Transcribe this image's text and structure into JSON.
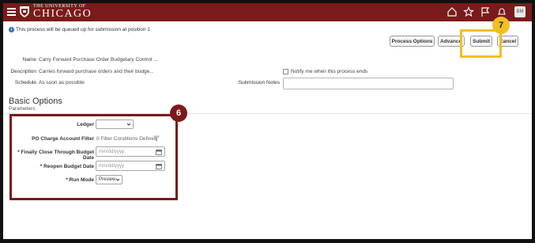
{
  "header": {
    "logo_line1": "THE UNIVERSITY OF",
    "logo_line2": "CHICAGO",
    "avatar_initials": "BM",
    "icons": [
      "home-icon",
      "star-icon",
      "flag-icon",
      "bell-icon"
    ]
  },
  "info_message": "This process will be queued up for submission at position 1",
  "buttons": {
    "process_options": "Process Options",
    "advanced": "Advance",
    "submit": "Submit",
    "cancel": "Cancel"
  },
  "callouts": {
    "step7": "7",
    "step6": "6"
  },
  "form": {
    "name_label": "Name",
    "name_value": "Carry Forward Purchase Order Budgetary Control ...",
    "description_label": "Description",
    "description_value": "Carries forward purchase orders and their budge...",
    "schedule_label": "Schedule",
    "schedule_value": "As soon as possible",
    "notify_label": "Notify me when this process ends",
    "submission_notes_label": "Submission Notes",
    "submission_notes_value": ""
  },
  "basic_options": {
    "title": "Basic Options",
    "subtitle": "Parameters"
  },
  "parameters": {
    "ledger_label": "Ledger",
    "ledger_value": "",
    "po_filter_label": "PO Charge Account Filter",
    "po_filter_value": "0 Filter Conditions Defined",
    "finally_close_label": "Finally Close Through Budget Date",
    "finally_close_placeholder": "mm/dd/yyyy",
    "reopen_label": "Reopen Budget Date",
    "reopen_placeholder": "mm/dd/yyyy",
    "run_mode_label": "Run Mode",
    "run_mode_value": "Preview",
    "required_marker": "*"
  },
  "colors": {
    "brand": "#7b1a1a",
    "callout_yellow": "#f0c020"
  }
}
